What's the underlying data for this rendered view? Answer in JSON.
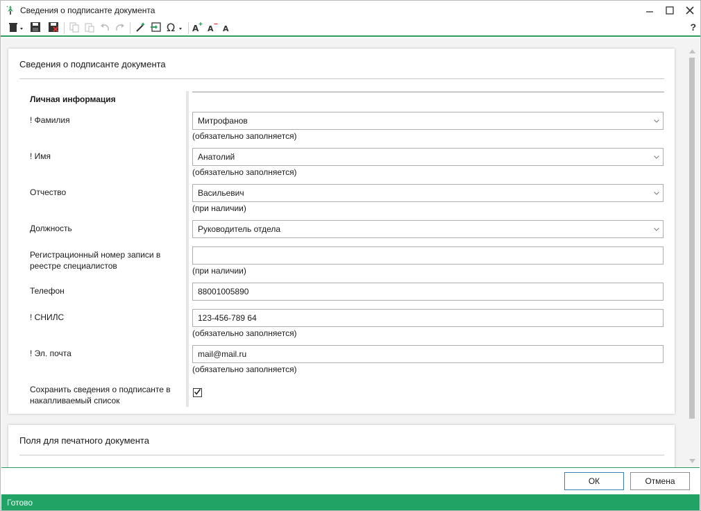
{
  "window": {
    "title": "Сведения о подписанте документа"
  },
  "toolbar": {
    "help_label": "?",
    "icons": [
      "trash-icon",
      "save-icon",
      "save-close-icon",
      "copy-icon",
      "paste-icon",
      "undo-icon",
      "redo-icon",
      "magic-wand-icon",
      "insert-icon",
      "omega-icon",
      "font-increase-icon",
      "font-decrease-icon",
      "font-reset-icon"
    ]
  },
  "panel1": {
    "title": "Сведения о подписанте документа",
    "section_header": "Личная информация",
    "fields": [
      {
        "label": "! Фамилия",
        "value": "Митрофанов",
        "hint": "(обязательно заполняется)",
        "dropdown": true
      },
      {
        "label": "! Имя",
        "value": "Анатолий",
        "hint": "(обязательно заполняется)",
        "dropdown": true
      },
      {
        "label": "Отчество",
        "value": "Васильевич",
        "hint": "(при наличии)",
        "dropdown": true
      },
      {
        "label": "Должность",
        "value": "Руководитель отдела",
        "hint": "",
        "dropdown": true
      },
      {
        "label": "Регистрационный номер записи в реестре специалистов",
        "value": "",
        "hint": "(при наличии)",
        "dropdown": false
      },
      {
        "label": "Телефон",
        "value": "88001005890",
        "hint": "",
        "dropdown": false
      },
      {
        "label": "! СНИЛС",
        "value": "123-456-789 64",
        "hint": "(обязательно заполняется)",
        "dropdown": false
      },
      {
        "label": "! Эл. почта",
        "value": "mail@mail.ru",
        "hint": "(обязательно заполняется)",
        "dropdown": false
      }
    ],
    "save_checkbox": {
      "label": "Сохранить сведения о подписанте в накапливаемый список",
      "checked": true
    }
  },
  "panel2": {
    "title": "Поля для печатного документа"
  },
  "buttons": {
    "ok": "ОК",
    "cancel": "Отмена"
  },
  "status": {
    "text": "Готово"
  },
  "colors": {
    "accent": "#21a366",
    "accent_line": "#2e9d5d"
  }
}
